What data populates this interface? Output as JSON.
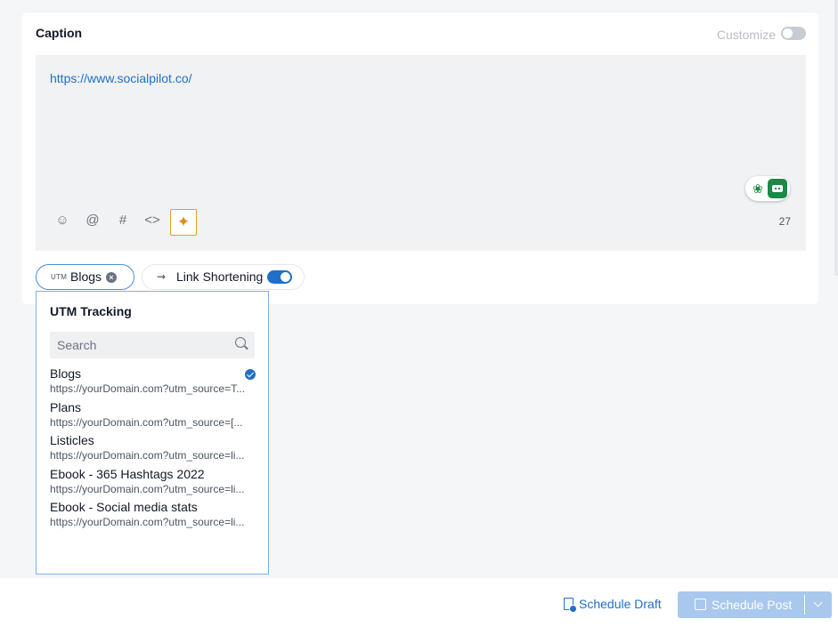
{
  "caption": {
    "title": "Caption",
    "customize_label": "Customize",
    "customize_enabled": false
  },
  "editor": {
    "text": "https://www.socialpilot.co/",
    "char_count": "27",
    "toolbar": [
      "emoji-icon",
      "mention-icon",
      "hashtag-icon",
      "code-icon",
      "ai-sparkle-icon"
    ]
  },
  "chips": {
    "utm": {
      "prefix": "UTM",
      "label": "Blogs"
    },
    "link_shortening": {
      "label": "Link Shortening",
      "enabled": true
    }
  },
  "utm_dropdown": {
    "title": "UTM Tracking",
    "search_placeholder": "Search",
    "items": [
      {
        "name": "Blogs",
        "url": "https://yourDomain.com?utm_source=T...",
        "selected": true
      },
      {
        "name": "Plans",
        "url": "https://yourDomain.com?utm_source=[...",
        "selected": false
      },
      {
        "name": "Listicles",
        "url": "https://yourDomain.com?utm_source=li...",
        "selected": false
      },
      {
        "name": "Ebook - 365 Hashtags 2022",
        "url": "https://yourDomain.com?utm_source=li...",
        "selected": false
      },
      {
        "name": "Ebook - Social media stats",
        "url": "https://yourDomain.com?utm_source=li...",
        "selected": false
      }
    ]
  },
  "footer": {
    "schedule_draft_label": "Schedule Draft",
    "schedule_post_label": "Schedule Post"
  },
  "colors": {
    "accent": "#1f6fc8",
    "primary_button_disabled": "#a9c8ee",
    "ai_accent": "#e08a12",
    "assistant_green": "#1a8a45"
  }
}
